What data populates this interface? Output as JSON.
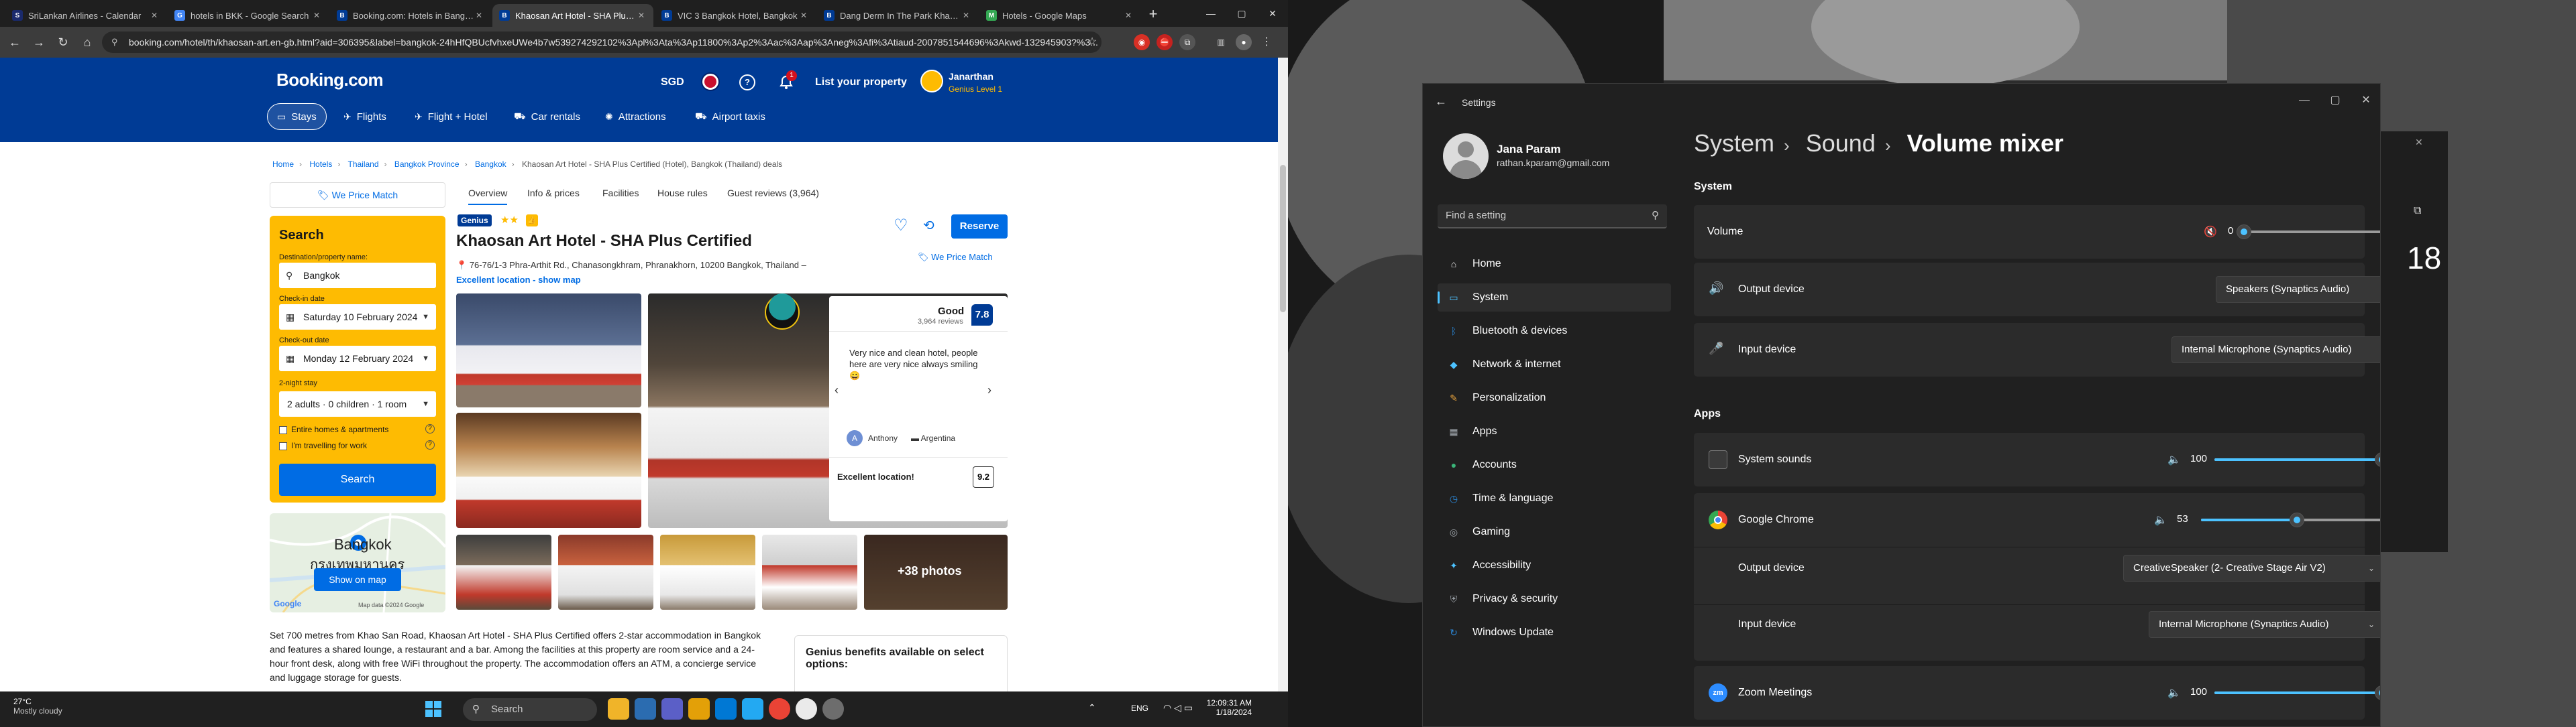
{
  "browser": {
    "tabs": [
      {
        "title": "SriLankan Airlines - Calendar",
        "color": "#1a2a6c",
        "letter": "S",
        "active": false
      },
      {
        "title": "hotels in BKK - Google Search",
        "color": "#4285f4",
        "letter": "G",
        "active": false
      },
      {
        "title": "Booking.com: Hotels in Bangkok",
        "color": "#003b95",
        "letter": "B",
        "active": false
      },
      {
        "title": "Khaosan Art Hotel - SHA Plus C",
        "color": "#003b95",
        "letter": "B",
        "active": true
      },
      {
        "title": "VIC 3 Bangkok Hotel, Bangkok",
        "color": "#003b95",
        "letter": "B",
        "active": false
      },
      {
        "title": "Dang Derm In The Park Khaosan",
        "color": "#003b95",
        "letter": "B",
        "active": false
      },
      {
        "title": "Hotels - Google Maps",
        "color": "#34a853",
        "letter": "M",
        "active": false
      }
    ],
    "url": "booking.com/hotel/th/khaosan-art.en-gb.html?aid=306395&label=bangkok-24hHfQBUcfvhxeUWe4b7w539274292102%3Apl%3Ata%3Ap11800%3Ap2%3Aac%3Aap%3Aneg%3Afi%3Atiaud-2007851544696%3Akwd-132945903?%3..."
  },
  "booking": {
    "logo": "Booking.com",
    "currency": "SGD",
    "notification_count": "1",
    "list_property": "List your property",
    "user_name": "Janarthan",
    "user_level": "Genius Level 1",
    "nav": [
      {
        "label": "Stays",
        "icon": "bed-icon",
        "glyph": "▭",
        "active": true
      },
      {
        "label": "Flights",
        "icon": "plane-icon",
        "glyph": "✈",
        "active": false
      },
      {
        "label": "Flight + Hotel",
        "icon": "plane-hotel-icon",
        "glyph": "✈",
        "active": false
      },
      {
        "label": "Car rentals",
        "icon": "car-icon",
        "glyph": "⛟",
        "active": false
      },
      {
        "label": "Attractions",
        "icon": "attractions-icon",
        "glyph": "✺",
        "active": false
      },
      {
        "label": "Airport taxis",
        "icon": "taxi-icon",
        "glyph": "⛟",
        "active": false
      }
    ],
    "breadcrumbs": [
      "Home",
      "Hotels",
      "Thailand",
      "Bangkok Province",
      "Bangkok",
      "Khaosan Art Hotel - SHA Plus Certified (Hotel), Bangkok (Thailand) deals"
    ],
    "price_match": "We Price Match",
    "search": {
      "title": "Search",
      "destination_label": "Destination/property name:",
      "destination_value": "Bangkok",
      "checkin_label": "Check-in date",
      "checkin_value": "Saturday 10 February 2024",
      "checkout_label": "Check-out date",
      "checkout_value": "Monday 12 February 2024",
      "stay_label": "2-night stay",
      "guests_value": "2 adults · 0 children · 1 room",
      "entire_homes": "Entire homes & apartments",
      "work_travel": "I'm travelling for work",
      "button": "Search"
    },
    "map": {
      "city": "Bangkok",
      "thai": "กรุงเทพมหานคร",
      "button": "Show on map",
      "google": "Google",
      "copyright": "Map data ©2024 Google"
    },
    "hotel_tabs": [
      "Overview",
      "Info & prices",
      "Facilities",
      "House rules",
      "Guest reviews (3,964)"
    ],
    "genius_badge": "Genius",
    "stars": "★★",
    "hotel_name": "Khaosan Art Hotel - SHA Plus Certified",
    "address": "76-76/1-3 Phra-Arthit Rd., Chanasongkhram, Phranakhorn, 10200 Bangkok, Thailand –",
    "location_link": "Excellent location - show map",
    "reserve": "Reserve",
    "review": {
      "label": "Good",
      "count": "3,964 reviews",
      "score": "7.8",
      "text": "Very nice and clean hotel, people here are very nice always smiling 😀",
      "avatar_letter": "A",
      "reviewer": "Anthony",
      "country": "Argentina",
      "location_label": "Excellent location!",
      "location_score": "9.2"
    },
    "more_photos": "+38 photos",
    "description": "Set 700 metres from Khao San Road, Khaosan Art Hotel - SHA Plus Certified offers 2-star accommodation in Bangkok and features a shared lounge, a restaurant and a bar. Among the facilities at this property are room service and a 24-hour front desk, along with free WiFi throughout the property. The accommodation offers an ATM, a concierge service and luggage storage for guests.",
    "genius_box": "Genius benefits available on select options:"
  },
  "taskbar": {
    "temp": "27°C",
    "weather": "Mostly cloudy",
    "search": "Search",
    "lang": "ENG",
    "time": "12:09:31 AM",
    "date": "1/18/2024"
  },
  "bg_window": {
    "number": "18"
  },
  "settings": {
    "window_title": "Settings",
    "user_name": "Jana Param",
    "email": "rathan.kparam@gmail.com",
    "search_placeholder": "Find a setting",
    "nav": [
      {
        "label": "Home",
        "icon": "home-icon",
        "color": "#e8e8e8",
        "glyph": "⌂"
      },
      {
        "label": "System",
        "icon": "system-icon",
        "color": "#4cc2ff",
        "glyph": "▭"
      },
      {
        "label": "Bluetooth & devices",
        "icon": "bluetooth-icon",
        "color": "#2b88d8",
        "glyph": "ᛒ"
      },
      {
        "label": "Network & internet",
        "icon": "network-icon",
        "color": "#4cc2ff",
        "glyph": "◆"
      },
      {
        "label": "Personalization",
        "icon": "brush-icon",
        "color": "#e8a33d",
        "glyph": "✎"
      },
      {
        "label": "Apps",
        "icon": "apps-icon",
        "color": "#9aa0a6",
        "glyph": "▦"
      },
      {
        "label": "Accounts",
        "icon": "accounts-icon",
        "color": "#3ab579",
        "glyph": "●"
      },
      {
        "label": "Time & language",
        "icon": "globe-icon",
        "color": "#2b88d8",
        "glyph": "◷"
      },
      {
        "label": "Gaming",
        "icon": "gaming-icon",
        "color": "#9aa0a6",
        "glyph": "◎"
      },
      {
        "label": "Accessibility",
        "icon": "accessibility-icon",
        "color": "#4cc2ff",
        "glyph": "✦"
      },
      {
        "label": "Privacy & security",
        "icon": "shield-icon",
        "color": "#9aa0a6",
        "glyph": "⛨"
      },
      {
        "label": "Windows Update",
        "icon": "update-icon",
        "color": "#2b88d8",
        "glyph": "↻"
      }
    ],
    "active_nav_index": 1,
    "breadcrumb": [
      "System",
      "Sound",
      "Volume mixer"
    ],
    "system_heading": "System",
    "volume": {
      "label": "Volume",
      "value": "0",
      "level": 0
    },
    "output_device": {
      "label": "Output device",
      "value": "Speakers (Synaptics Audio)"
    },
    "input_device": {
      "label": "Input device",
      "value": "Internal Microphone (Synaptics Audio)"
    },
    "apps_heading": "Apps",
    "apps": [
      {
        "name": "System sounds",
        "value": "100",
        "level": 1.0,
        "icon": "system-sounds-icon",
        "expanded": false
      },
      {
        "name": "Google Chrome",
        "value": "53",
        "level": 0.53,
        "icon": "chrome-icon",
        "expanded": true,
        "output_label": "Output device",
        "output_value": "CreativeSpeaker (2- Creative Stage Air V2)",
        "input_label": "Input device",
        "input_value": "Internal Microphone (Synaptics Audio)"
      },
      {
        "name": "Zoom Meetings",
        "value": "100",
        "level": 1.0,
        "icon": "zoom-icon",
        "expanded": false
      }
    ]
  }
}
